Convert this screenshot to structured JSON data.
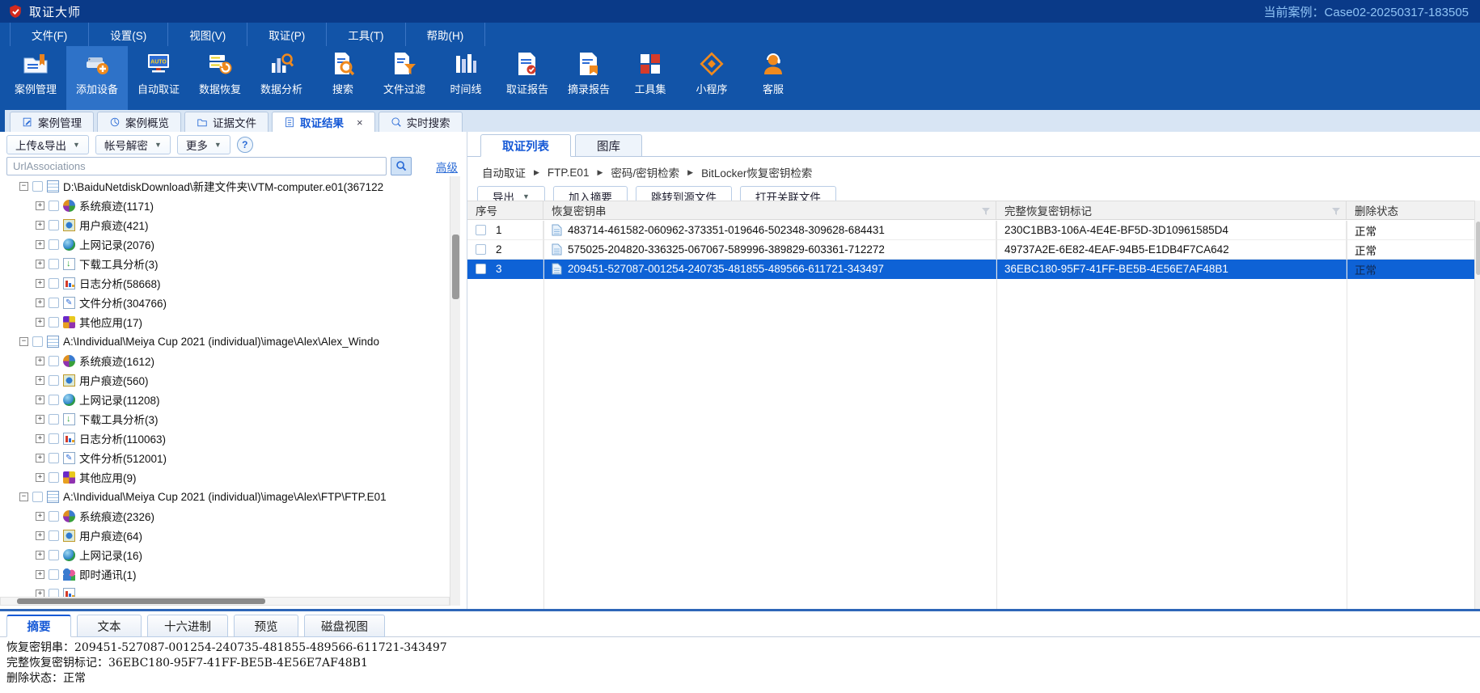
{
  "colors": {
    "titlebar": "#0a3a88",
    "toolbar_blue": "#1254a8",
    "accent_blue": "#1659d6",
    "selection_blue": "#0e62d6",
    "tabstrip_bg": "#d8e5f4"
  },
  "title_bar": {
    "app_title": "取证大师",
    "case_label": "当前案例：",
    "case_value": "Case02-20250317-183505"
  },
  "menu_bar": {
    "items": [
      {
        "label": "文件(F)"
      },
      {
        "label": "设置(S)"
      },
      {
        "label": "视图(V)"
      },
      {
        "label": "取证(P)"
      },
      {
        "label": "工具(T)"
      },
      {
        "label": "帮助(H)"
      }
    ]
  },
  "toolbar": {
    "items": [
      {
        "label": "案例管理",
        "icon": "case-manage-icon",
        "active": false
      },
      {
        "label": "添加设备",
        "icon": "add-device-icon",
        "active": true
      },
      {
        "label": "自动取证",
        "icon": "auto-forensics-icon",
        "active": false
      },
      {
        "label": "数据恢复",
        "icon": "data-recovery-icon",
        "active": false
      },
      {
        "label": "数据分析",
        "icon": "data-analysis-icon",
        "active": false
      },
      {
        "label": "搜索",
        "icon": "search-doc-icon",
        "active": false
      },
      {
        "label": "文件过滤",
        "icon": "file-filter-icon",
        "active": false
      },
      {
        "label": "时间线",
        "icon": "timeline-icon",
        "active": false
      },
      {
        "label": "取证报告",
        "icon": "forensic-report-icon",
        "active": false
      },
      {
        "label": "摘录报告",
        "icon": "excerpt-report-icon",
        "active": false
      },
      {
        "label": "工具集",
        "icon": "toolset-icon",
        "active": false
      },
      {
        "label": "小程序",
        "icon": "mini-program-icon",
        "active": false
      },
      {
        "label": "客服",
        "icon": "customer-service-icon",
        "active": false
      }
    ]
  },
  "main_tabs": {
    "items": [
      {
        "label": "案例管理",
        "icon": "tab-case-manage-icon",
        "active": false,
        "closable": false
      },
      {
        "label": "案例概览",
        "icon": "tab-case-overview-icon",
        "active": false,
        "closable": false
      },
      {
        "label": "证据文件",
        "icon": "tab-evidence-file-icon",
        "active": false,
        "closable": false
      },
      {
        "label": "取证结果",
        "icon": "tab-forensic-result-icon",
        "active": true,
        "closable": true
      },
      {
        "label": "实时搜索",
        "icon": "tab-realtime-search-icon",
        "active": false,
        "closable": false
      }
    ],
    "close_glyph": "×"
  },
  "left_panel": {
    "buttons": [
      {
        "label": "上传&导出",
        "dropdown": true
      },
      {
        "label": "帐号解密",
        "dropdown": true
      },
      {
        "label": "更多",
        "dropdown": true
      }
    ],
    "help_label": "?",
    "search": {
      "value": "UrlAssociations",
      "advanced_label": "高级"
    },
    "tree": [
      {
        "label": "D:\\BaiduNetdiskDownload\\新建文件夹\\VTM-computer.e01(367122",
        "level": 0,
        "expand": "minus",
        "icon": "evidence-file-icon"
      },
      {
        "label": "系统痕迹(1171)",
        "level": 1,
        "expand": "plus",
        "icon": "system-trace-icon"
      },
      {
        "label": "用户痕迹(421)",
        "level": 1,
        "expand": "plus",
        "icon": "user-trace-icon"
      },
      {
        "label": "上网记录(2076)",
        "level": 1,
        "expand": "plus",
        "icon": "web-record-icon"
      },
      {
        "label": "下载工具分析(3)",
        "level": 1,
        "expand": "plus",
        "icon": "download-tool-icon"
      },
      {
        "label": "日志分析(58668)",
        "level": 1,
        "expand": "plus",
        "icon": "log-analysis-icon"
      },
      {
        "label": "文件分析(304766)",
        "level": 1,
        "expand": "plus",
        "icon": "file-analysis-icon"
      },
      {
        "label": "其他应用(17)",
        "level": 1,
        "expand": "plus",
        "icon": "other-apps-icon"
      },
      {
        "label": "A:\\Individual\\Meiya Cup 2021 (individual)\\image\\Alex\\Alex_Windo",
        "level": 0,
        "expand": "minus",
        "icon": "evidence-file-icon"
      },
      {
        "label": "系统痕迹(1612)",
        "level": 1,
        "expand": "plus",
        "icon": "system-trace-icon"
      },
      {
        "label": "用户痕迹(560)",
        "level": 1,
        "expand": "plus",
        "icon": "user-trace-icon"
      },
      {
        "label": "上网记录(11208)",
        "level": 1,
        "expand": "plus",
        "icon": "web-record-icon"
      },
      {
        "label": "下载工具分析(3)",
        "level": 1,
        "expand": "plus",
        "icon": "download-tool-icon"
      },
      {
        "label": "日志分析(110063)",
        "level": 1,
        "expand": "plus",
        "icon": "log-analysis-icon"
      },
      {
        "label": "文件分析(512001)",
        "level": 1,
        "expand": "plus",
        "icon": "file-analysis-icon"
      },
      {
        "label": "其他应用(9)",
        "level": 1,
        "expand": "plus",
        "icon": "other-apps-icon"
      },
      {
        "label": "A:\\Individual\\Meiya Cup 2021 (individual)\\image\\Alex\\FTP\\FTP.E01",
        "level": 0,
        "expand": "minus",
        "icon": "evidence-file-icon"
      },
      {
        "label": "系统痕迹(2326)",
        "level": 1,
        "expand": "plus",
        "icon": "system-trace-icon"
      },
      {
        "label": "用户痕迹(64)",
        "level": 1,
        "expand": "plus",
        "icon": "user-trace-icon"
      },
      {
        "label": "上网记录(16)",
        "level": 1,
        "expand": "plus",
        "icon": "web-record-icon"
      },
      {
        "label": "即时通讯(1)",
        "level": 1,
        "expand": "plus",
        "icon": "im-icon"
      },
      {
        "label": "",
        "level": 1,
        "expand": "plus",
        "icon": "log-analysis-icon"
      }
    ]
  },
  "right_panel": {
    "tabs": [
      {
        "label": "取证列表",
        "active": true
      },
      {
        "label": "图库",
        "active": false
      }
    ],
    "breadcrumb": [
      "自动取证",
      "FTP.E01",
      "密码/密钥检索",
      "BitLocker恢复密钥检索"
    ],
    "buttons": [
      {
        "label": "导出",
        "dropdown": true
      },
      {
        "label": "加入摘要",
        "dropdown": false
      },
      {
        "label": "跳转到源文件",
        "dropdown": false
      },
      {
        "label": "打开关联文件",
        "dropdown": false
      }
    ],
    "table": {
      "columns": [
        "序号",
        "恢复密钥串",
        "完整恢复密钥标记",
        "删除状态"
      ],
      "rows": [
        {
          "no": "1",
          "key": "483714-461582-060962-373351-019646-502348-309628-684431",
          "guid": "230C1BB3-106A-4E4E-BF5D-3D10961585D4",
          "status": "正常",
          "selected": false
        },
        {
          "no": "2",
          "key": "575025-204820-336325-067067-589996-389829-603361-712272",
          "guid": "49737A2E-6E82-4EAF-94B5-E1DB4F7CA642",
          "status": "正常",
          "selected": false
        },
        {
          "no": "3",
          "key": "209451-527087-001254-240735-481855-489566-611721-343497",
          "guid": "36EBC180-95F7-41FF-BE5B-4E56E7AF48B1",
          "status": "正常",
          "selected": true
        }
      ]
    }
  },
  "bottom_panel": {
    "tabs": [
      {
        "label": "摘要",
        "active": true
      },
      {
        "label": "文本",
        "active": false
      },
      {
        "label": "十六进制",
        "active": false
      },
      {
        "label": "预览",
        "active": false
      },
      {
        "label": "磁盘视图",
        "active": false
      }
    ],
    "summary": [
      {
        "label": "恢复密钥串：",
        "value": "209451-527087-001254-240735-481855-489566-611721-343497"
      },
      {
        "label": "完整恢复密钥标记：",
        "value": "36EBC180-95F7-41FF-BE5B-4E56E7AF48B1"
      },
      {
        "label": "删除状态：",
        "value": "正常"
      }
    ]
  }
}
